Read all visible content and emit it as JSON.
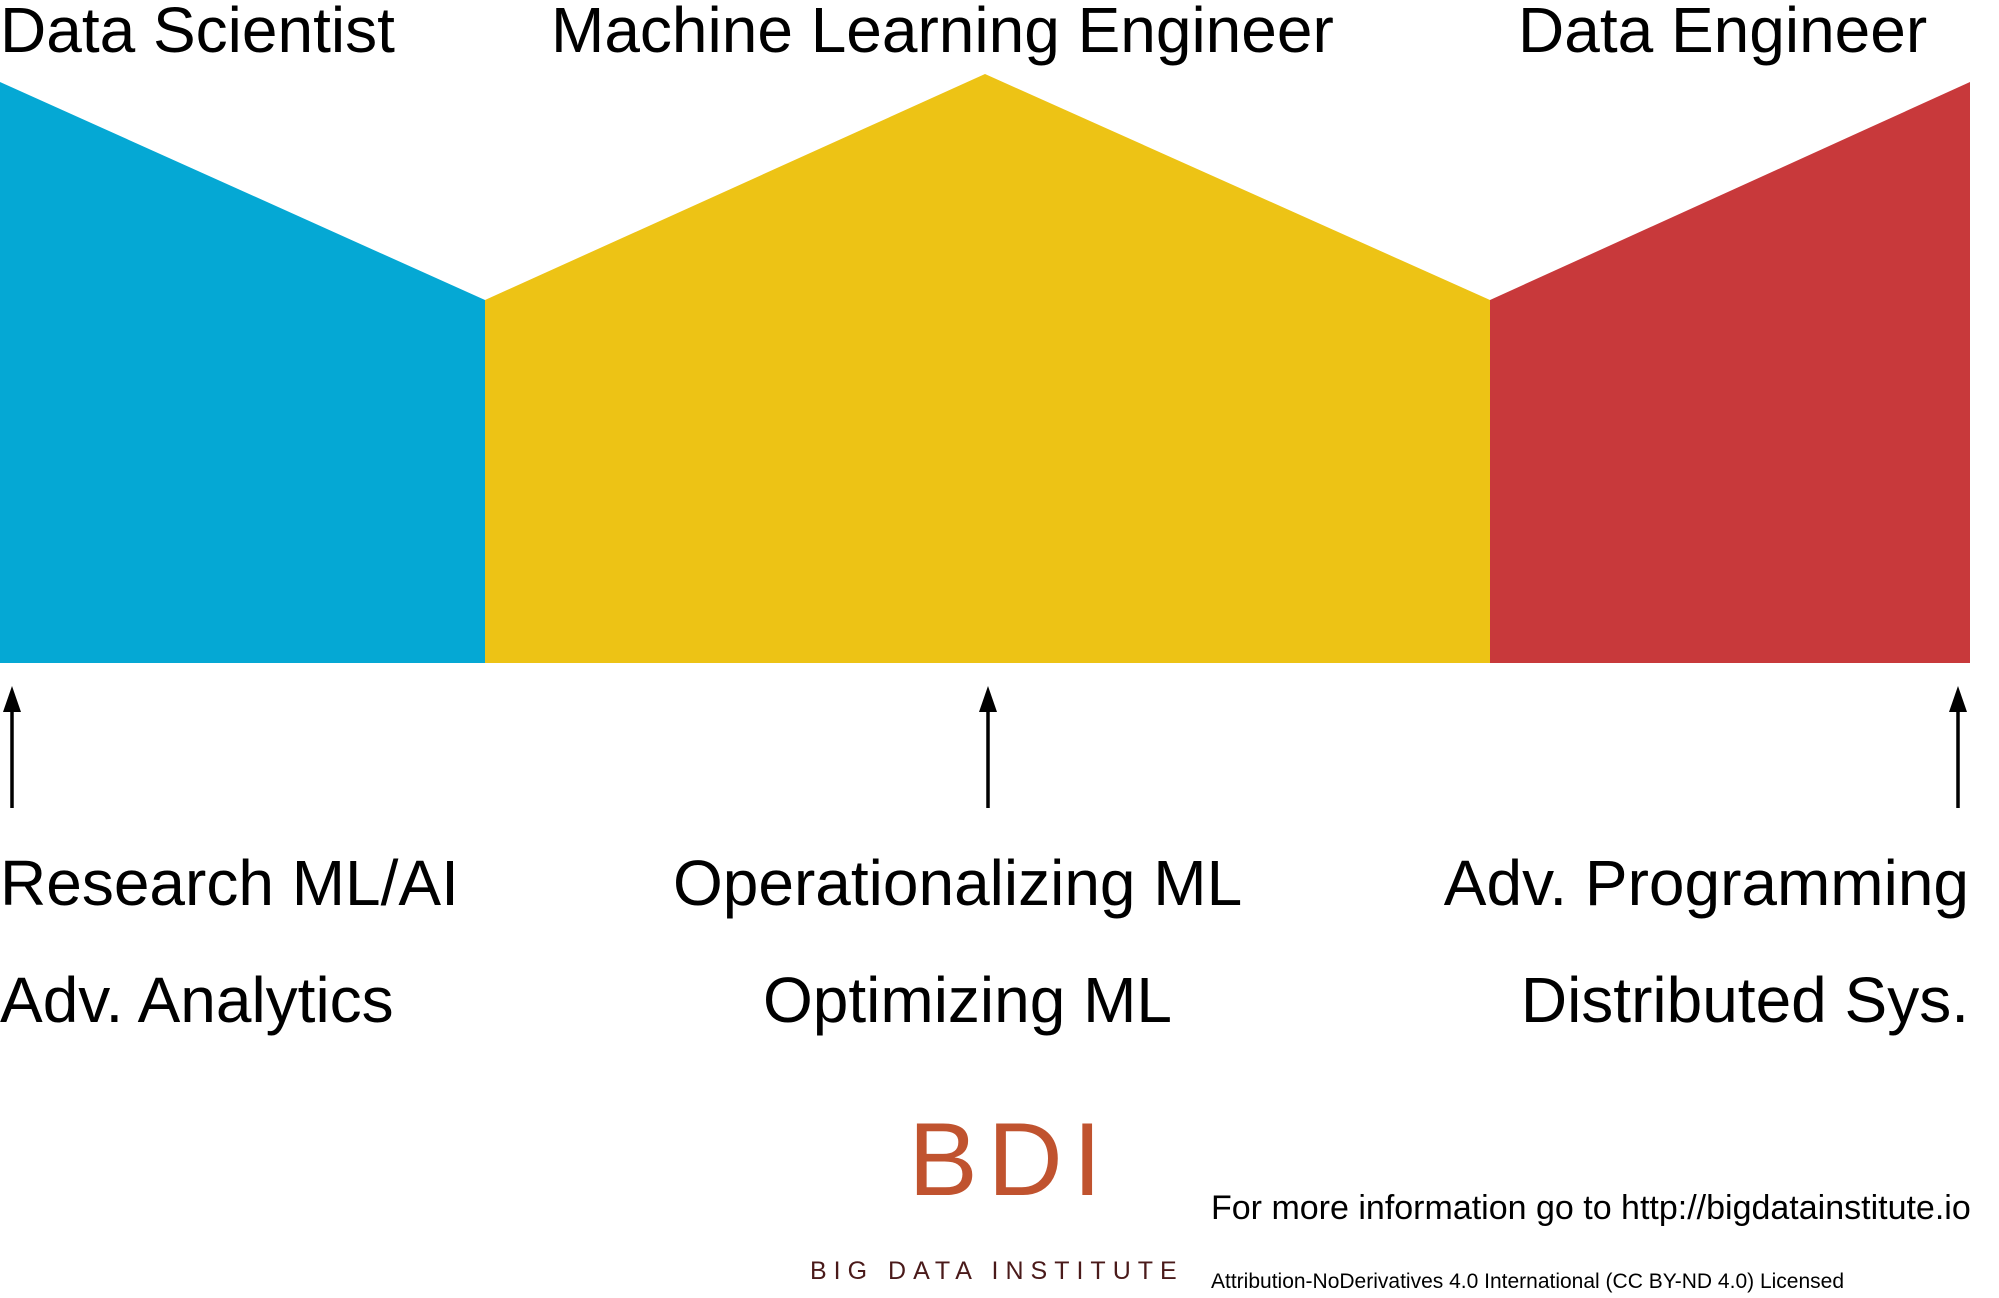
{
  "roles": [
    {
      "title": "Data Scientist",
      "color": "#05a8d4",
      "skills": [
        "Research ML/AI",
        "Adv. Analytics"
      ]
    },
    {
      "title": "Machine Learning Engineer",
      "color": "#edc315",
      "skills": [
        "Operationalizing ML",
        "Optimizing ML"
      ]
    },
    {
      "title": "Data Engineer",
      "color": "#c8393b",
      "skills": [
        "Adv. Programming",
        "Distributed Sys."
      ]
    }
  ],
  "logo": {
    "mark": "BDI",
    "name": "BIG DATA INSTITUTE",
    "color": "#c0532f",
    "name_color": "#4a1a1a"
  },
  "footer": {
    "info": "For more information go to http://bigdatainstitute.io",
    "license": "Attribution-NoDerivatives 4.0 International (CC BY-ND 4.0) Licensed"
  },
  "icons": {
    "arrows": [
      "up-arrow-icon",
      "up-arrow-icon",
      "up-arrow-icon"
    ]
  }
}
